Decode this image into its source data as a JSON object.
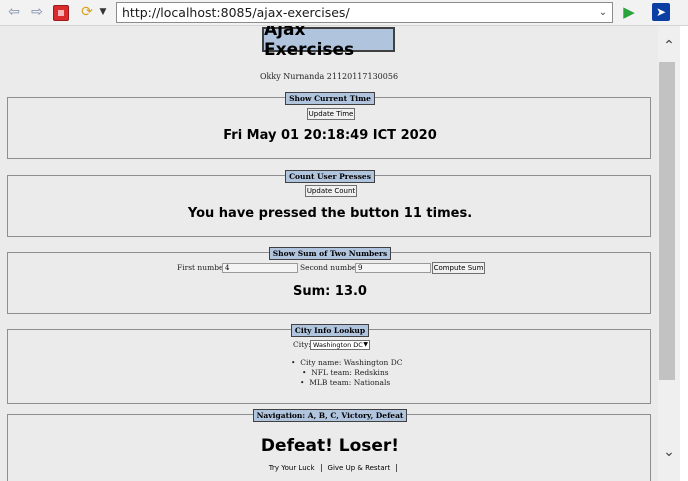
{
  "browser": {
    "url": "http://localhost:8085/ajax-exercises/"
  },
  "page": {
    "title": "Ajax Exercises",
    "author": "Okky Nurnanda 21120117130056"
  },
  "sections": {
    "time": {
      "legend": "Show Current Time",
      "button_label": "Update Time",
      "result": "Fri May 01 20:18:49 ICT 2020"
    },
    "count": {
      "legend": "Count User Presses",
      "button_label": "Update Count",
      "result": "You have pressed the button 11 times."
    },
    "sum": {
      "legend": "Show Sum of Two Numbers",
      "first_label": "First number:",
      "first_value": "4",
      "second_label": "Second number:",
      "second_value": "9",
      "button_label": "Compute Sum",
      "result": "Sum: 13.0"
    },
    "city": {
      "legend": "City Info Lookup",
      "select_label": "City:",
      "selected": "Washington DC",
      "info": {
        "city_name": "City name: Washington DC",
        "nfl": "NFL team: Redskins",
        "mlb": "MLB team: Nationals"
      }
    },
    "nav": {
      "legend": "Navigation: A, B, C, Victory, Defeat",
      "result": "Defeat! Loser!",
      "links": [
        "Try Your Luck",
        "Give Up & Restart"
      ]
    }
  }
}
